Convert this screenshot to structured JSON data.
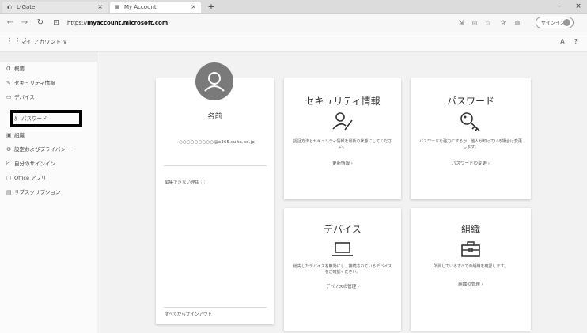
{
  "browser": {
    "tabs": [
      {
        "title": "L-Gate",
        "icon": "l-gate-favicon",
        "close": "×"
      },
      {
        "title": "My Account",
        "icon": "ms-favicon",
        "close": "×"
      }
    ],
    "new_tab": "+",
    "window_controls": {
      "minimize": "–",
      "close": "×"
    },
    "nav": {
      "back": "←",
      "forward": "→",
      "refresh": "↻"
    },
    "url_prefix": "https://",
    "url_host": "myaccount.microsoft.com",
    "profile_label": "サインイン"
  },
  "app": {
    "title": "マイ アカウント ∨",
    "help": "?",
    "settings": "A"
  },
  "sidebar": {
    "items": [
      {
        "label": "概要",
        "icon": "person-icon"
      },
      {
        "label": "セキュリティ情報",
        "icon": "security-icon"
      },
      {
        "label": "デバイス",
        "icon": "device-icon"
      },
      {
        "label": "パスワード",
        "icon": "key-icon"
      },
      {
        "label": "組織",
        "icon": "briefcase-icon"
      },
      {
        "label": "設定およびプライバシー",
        "icon": "gear-icon"
      },
      {
        "label": "自分のサインイン",
        "icon": "signin-icon"
      },
      {
        "label": "Office アプリ",
        "icon": "office-icon"
      },
      {
        "label": "サブスクリプション",
        "icon": "subscription-icon"
      }
    ]
  },
  "profile_card": {
    "name": "名前",
    "email": "○○○○○○○○○@o365.suita.ed.jp",
    "note": "編集できない理由 ⓘ",
    "signout_all": "すべてからサインアウト"
  },
  "tiles": {
    "security": {
      "title": "セキュリティ情報",
      "desc": "認証方法とセキュリティ情報を最新の状態にしてください。",
      "link": "更新情報 ›"
    },
    "password": {
      "title": "パスワード",
      "desc": "パスワードを強力にするか、他人が知っている場合は変更します。",
      "link": "パスワードの変更 ›"
    },
    "devices": {
      "title": "デバイス",
      "desc": "紛失したデバイスを無効にし、接続されているデバイスをご確認ください。",
      "link": "デバイスの管理 ›"
    },
    "organization": {
      "title": "組織",
      "desc": "所属しているすべての組織を確認します。",
      "link": "組織の管理 ›"
    }
  }
}
